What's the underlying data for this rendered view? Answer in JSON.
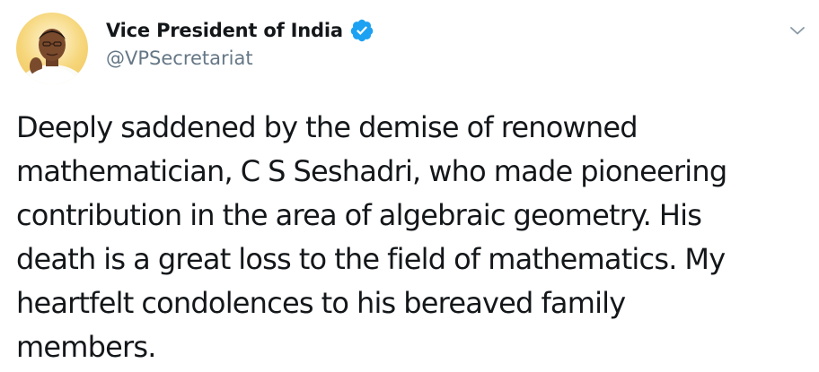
{
  "author": {
    "display_name": "Vice President of India",
    "handle": "@VPSecretariat",
    "verified": true,
    "avatar": "profile-photo"
  },
  "tweet": {
    "text": "Deeply saddened by the demise of renowned\nmathematician, C S Seshadri, who made pioneering\ncontribution in the area of algebraic geometry. His\ndeath is a great loss to the field of mathematics. My\nheartfelt condolences to his bereaved family\nmembers."
  },
  "icons": {
    "verified": "verified-badge-icon",
    "menu": "chevron-down-icon"
  },
  "colors": {
    "text_primary": "#14171a",
    "text_secondary": "#657786",
    "verified_blue": "#1da1f2",
    "background": "#ffffff"
  }
}
